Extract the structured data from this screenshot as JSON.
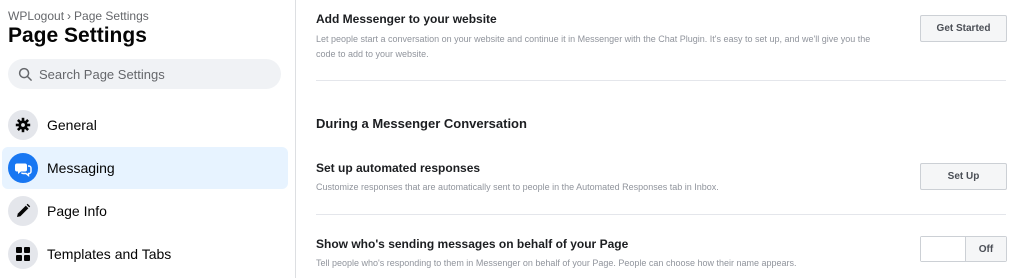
{
  "sidebar": {
    "breadcrumb": {
      "parent": "WPLogout",
      "separator": "›",
      "current": "Page Settings"
    },
    "title": "Page Settings",
    "search": {
      "placeholder": "Search Page Settings"
    },
    "items": [
      {
        "label": "General",
        "icon": "gear-icon",
        "active": false
      },
      {
        "label": "Messaging",
        "icon": "messenger-icon",
        "active": true
      },
      {
        "label": "Page Info",
        "icon": "pencil-icon",
        "active": false
      },
      {
        "label": "Templates and Tabs",
        "icon": "grid-icon",
        "active": false
      }
    ]
  },
  "main": {
    "add_messenger": {
      "title": "Add Messenger to your website",
      "description": "Let people start a conversation on your website and continue it in Messenger with the Chat Plugin. It's easy to set up, and we'll give you the code to add to your website.",
      "button": "Get Started"
    },
    "section_title": "During a Messenger Conversation",
    "automated": {
      "title": "Set up automated responses",
      "description": "Customize responses that are automatically sent to people in the Automated Responses tab in Inbox.",
      "button": "Set Up"
    },
    "show_sender": {
      "title": "Show who's sending messages on behalf of your Page",
      "description": "Tell people who's responding to them in Messenger on behalf of your Page. People can choose how their name appears.",
      "toggle_state": "Off"
    }
  },
  "colors": {
    "accent": "#1877f2",
    "active_bg": "#e7f3ff",
    "muted_text": "#90949c"
  }
}
